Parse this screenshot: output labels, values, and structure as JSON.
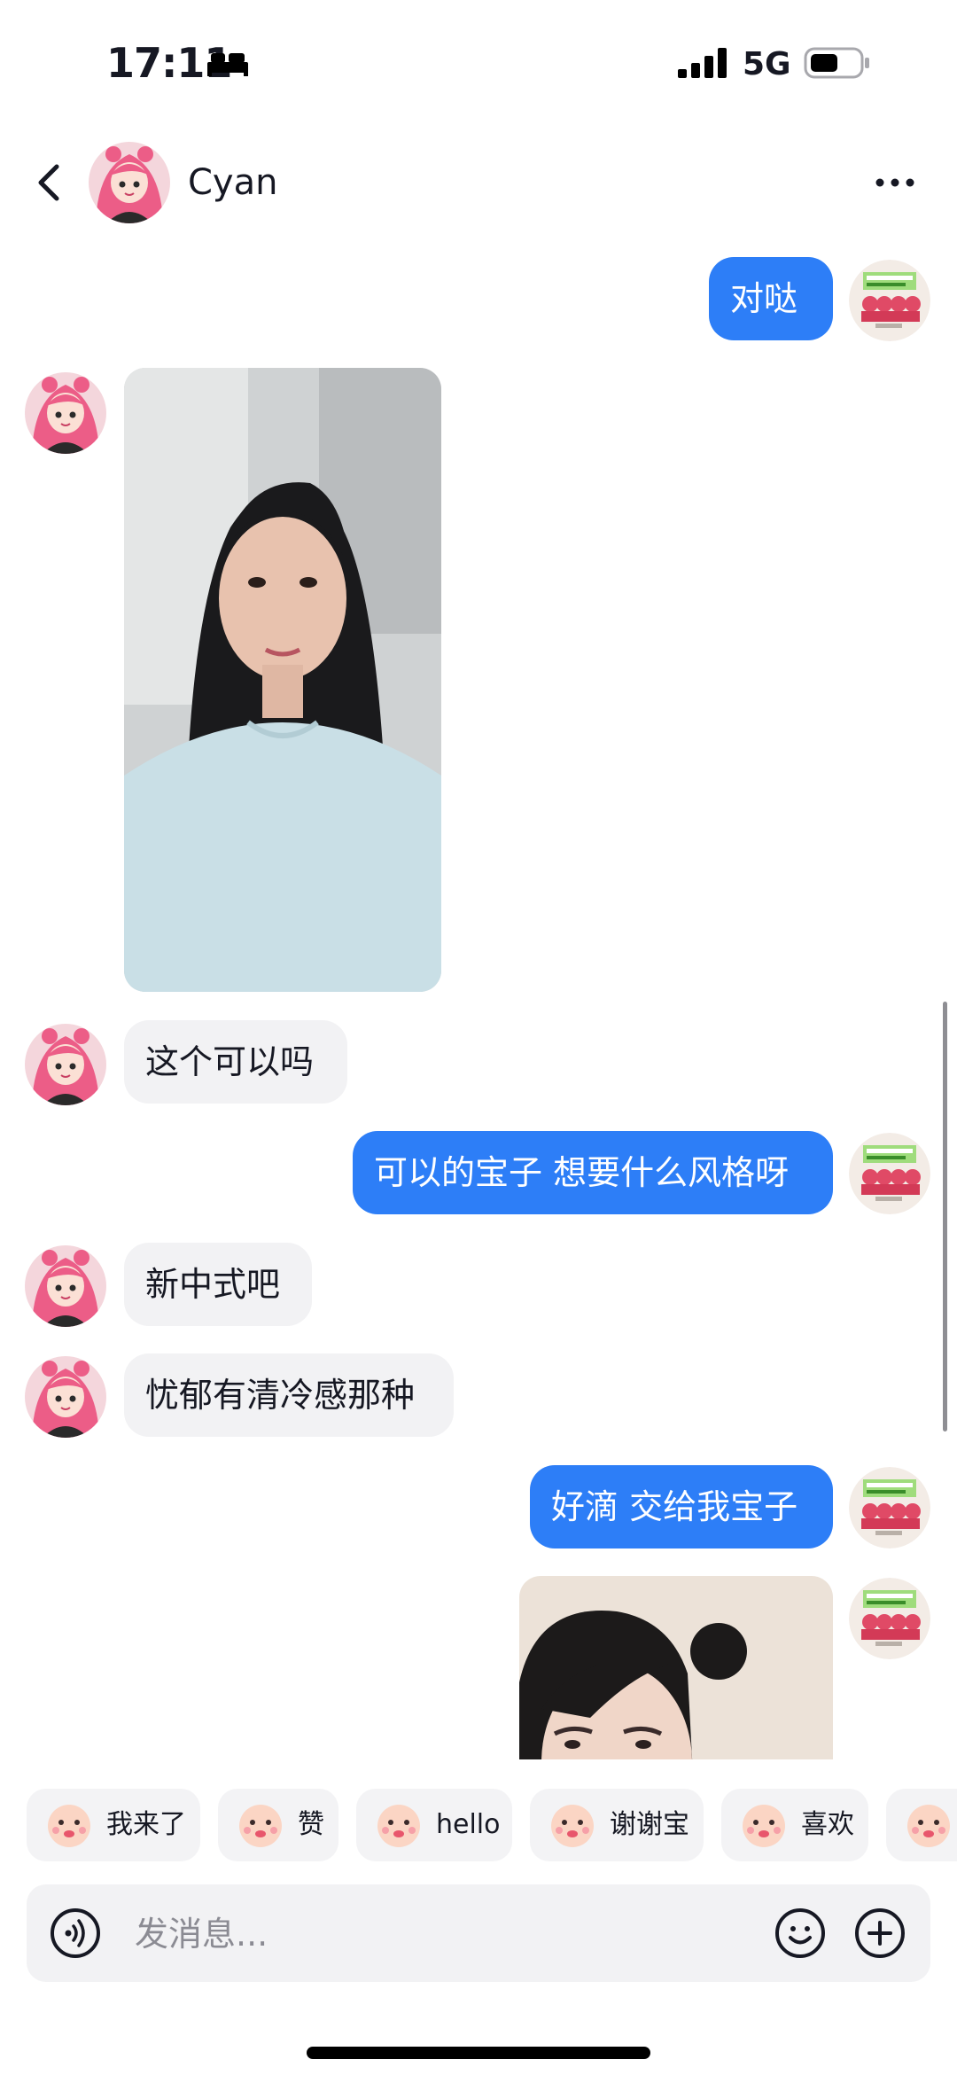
{
  "status_bar": {
    "time": "17:11",
    "network": "5G",
    "icons": [
      "sleep-focus-icon",
      "signal-icon",
      "battery-icon"
    ]
  },
  "header": {
    "contact_name": "Cyan",
    "icons": [
      "back-icon",
      "more-icon"
    ]
  },
  "messages": [
    {
      "from": "me",
      "type": "text",
      "text": "对哒"
    },
    {
      "from": "contact",
      "type": "image",
      "description": "photo"
    },
    {
      "from": "contact",
      "type": "text",
      "text": "这个可以吗"
    },
    {
      "from": "me",
      "type": "text",
      "text": "可以的宝子 想要什么风格呀"
    },
    {
      "from": "contact",
      "type": "text",
      "text": "新中式吧"
    },
    {
      "from": "contact",
      "type": "text",
      "text": "忧郁有清冷感那种"
    },
    {
      "from": "me",
      "type": "text",
      "text": "好滴 交给我宝子"
    },
    {
      "from": "me",
      "type": "image",
      "description": "photo"
    }
  ],
  "quick_replies": [
    {
      "label": "我来了",
      "icon": "sticker-icon"
    },
    {
      "label": "赞",
      "icon": "sticker-icon"
    },
    {
      "label": "hello",
      "icon": "sticker-icon"
    },
    {
      "label": "谢谢宝",
      "icon": "sticker-icon"
    },
    {
      "label": "喜欢",
      "icon": "sticker-icon"
    },
    {
      "label": "",
      "icon": "sticker-icon"
    }
  ],
  "input": {
    "placeholder": "发消息...",
    "value": ""
  },
  "colors": {
    "accent": "#2d7ef7",
    "incoming_bubble": "#f2f2f4",
    "background": "#ffffff"
  }
}
